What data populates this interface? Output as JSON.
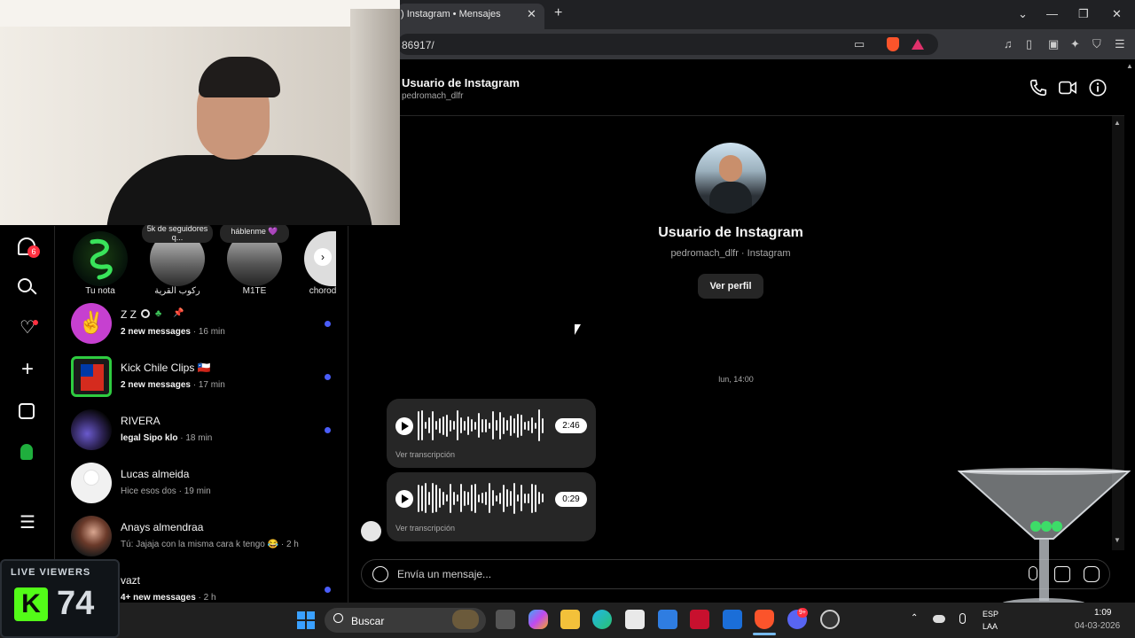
{
  "browser": {
    "tab_title": ") Instagram • Mensajes",
    "url": "86917/"
  },
  "stories": [
    {
      "label": "Tu nota",
      "bubble": ""
    },
    {
      "label": "ركوب القرية",
      "bubble": "5k de seguidores q..."
    },
    {
      "label": "M1TE",
      "bubble": "háblenme 💜"
    },
    {
      "label": "chorod",
      "bubble": ""
    }
  ],
  "nav": {
    "notifications_badge": "6"
  },
  "conversations": [
    {
      "name": "Z Z",
      "preview_bold": "2 new messages",
      "preview": " · 16 min",
      "unread": true
    },
    {
      "name": "Kick Chile Clips 🇨🇱",
      "preview_bold": "2 new messages",
      "preview": " · 17 min",
      "unread": true
    },
    {
      "name": "RIVERA",
      "preview_bold": "legal Sipo klo",
      "preview": " · 18 min",
      "unread": true
    },
    {
      "name": "Lucas almeida",
      "preview_bold": "",
      "preview": "Hice esos dos · 19 min",
      "unread": false
    },
    {
      "name": "Anays almendraa",
      "preview_bold": "",
      "preview": "Tú: Jajaja con la misma cara k tengo 😂 · 2 h",
      "unread": false
    },
    {
      "name": "vazt",
      "preview_bold": "4+ new messages",
      "preview": " · 2 h",
      "unread": true
    }
  ],
  "chat": {
    "header_name": "Usuario de Instagram",
    "header_user": "pedromach_dlfr",
    "profile_name": "Usuario de Instagram",
    "profile_sub": "pedromach_dlfr · Instagram",
    "profile_button": "Ver perfil",
    "timestamp": "lun, 14:00",
    "voice_messages": [
      {
        "duration": "2:46",
        "transcript_label": "Ver transcripción"
      },
      {
        "duration": "0:29",
        "transcript_label": "Ver transcripción"
      }
    ],
    "composer_placeholder": "Envía un mensaje..."
  },
  "taskbar": {
    "search_label": "Buscar",
    "lang_top": "ESP",
    "lang_bottom": "LAA",
    "time": "1:09",
    "date": "04-03-2026",
    "discord_badge": "9+"
  },
  "live_widget": {
    "title": "LIVE VIEWERS",
    "count": "74",
    "logo_letter": "K"
  },
  "colors": {
    "unread_dot": "#4a5df9",
    "kick_green": "#53fc18",
    "badge_red": "#ff3040"
  }
}
